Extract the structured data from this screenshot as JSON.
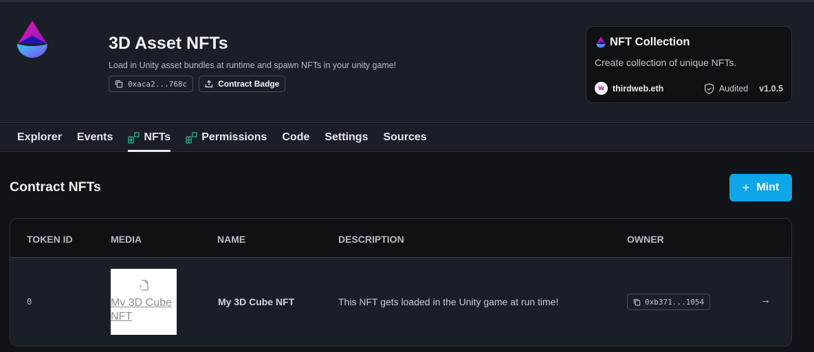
{
  "header": {
    "title": "3D Asset NFTs",
    "subtitle": "Load in Unity asset bundles at runtime and spawn NFTs in your unity game!",
    "address": "0xaca2...768c",
    "badge_label": "Contract Badge"
  },
  "card": {
    "title": "NFT Collection",
    "description": "Create collection of unique NFTs.",
    "publisher": "thirdweb.eth",
    "audited_label": "Audited",
    "version": "v1.0.5"
  },
  "tabs": [
    {
      "label": "Explorer",
      "icon": false
    },
    {
      "label": "Events",
      "icon": false
    },
    {
      "label": "NFTs",
      "icon": true,
      "active": true
    },
    {
      "label": "Permissions",
      "icon": true
    },
    {
      "label": "Code",
      "icon": false
    },
    {
      "label": "Settings",
      "icon": false
    },
    {
      "label": "Sources",
      "icon": false
    }
  ],
  "main": {
    "section_title": "Contract NFTs",
    "mint_label": "Mint",
    "columns": [
      "TOKEN ID",
      "MEDIA",
      "NAME",
      "DESCRIPTION",
      "OWNER"
    ],
    "rows": [
      {
        "token_id": "0",
        "media_alt": "My 3D Cube NFT",
        "name": "My 3D Cube NFT",
        "description": "This NFT gets loaded in the Unity game at run time!",
        "owner": "0xb371...1054"
      }
    ]
  },
  "colors": {
    "accent": "#0ea5e9",
    "tab_icon": "#26b587"
  }
}
